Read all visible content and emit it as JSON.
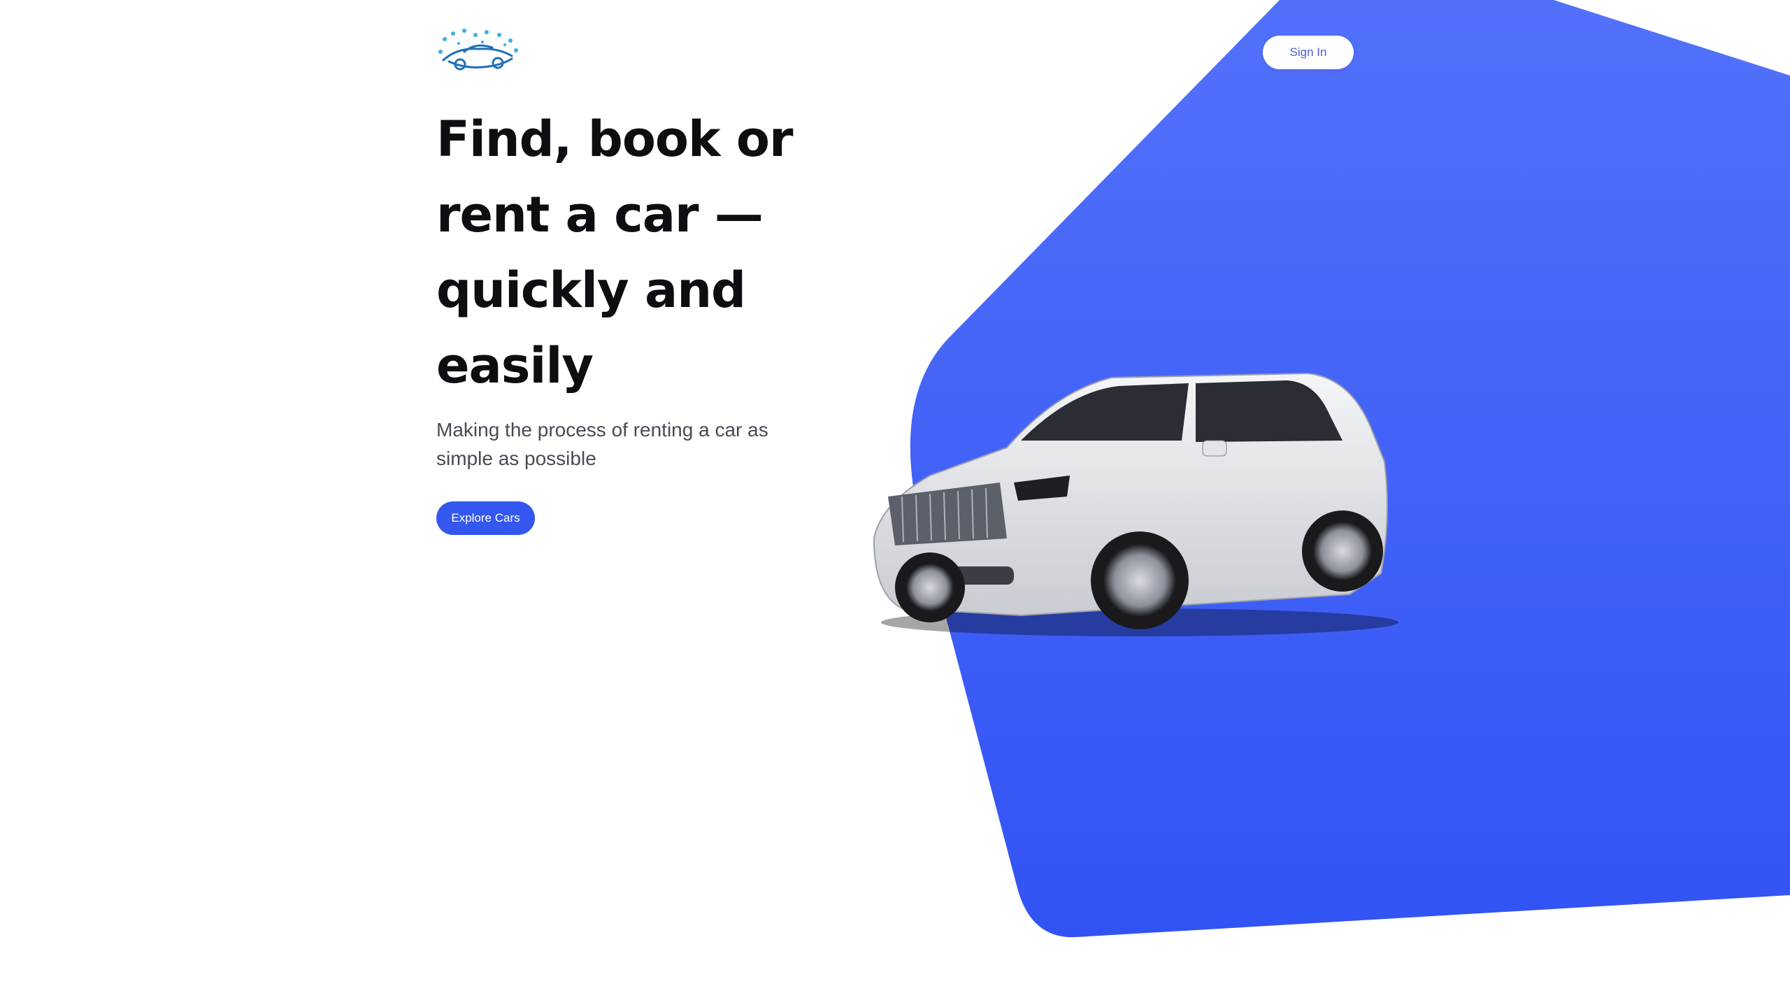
{
  "header": {
    "logo_icon": "car-wash-logo-icon",
    "signin_label": "Sign In"
  },
  "hero": {
    "title": "Find, book or rent a car — quickly and easily",
    "subtitle": "Making the process of renting a car as simple as possible",
    "cta_label": "Explore Cars"
  },
  "colors": {
    "accent": "#3457f0",
    "shape_top": "#4b6cf8",
    "shape_bottom": "#3455f4",
    "title": "#0d0d12",
    "subtitle": "#4a4a55"
  }
}
